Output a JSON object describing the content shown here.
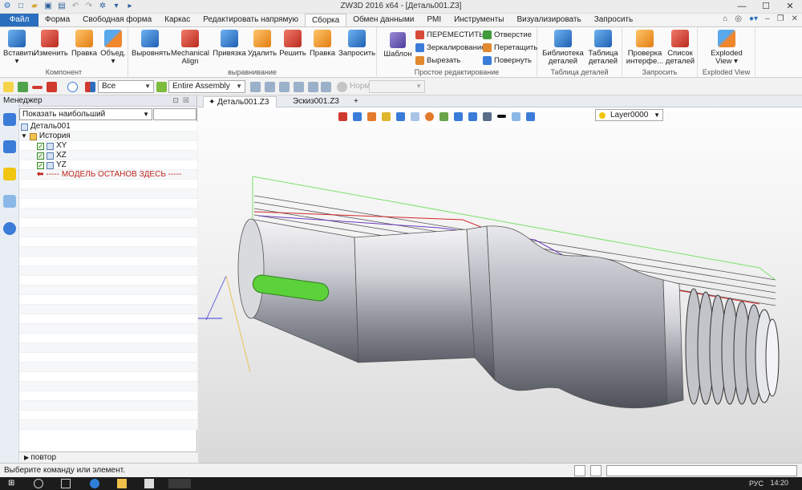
{
  "window": {
    "title": "ZW3D 2016  x64 - [Деталь001.Z3]"
  },
  "menu": {
    "file": "Файл",
    "tabs": [
      "Форма",
      "Свободная форма",
      "Каркас",
      "Редактировать напрямую",
      "Сборка",
      "Обмен данными",
      "PMI",
      "Инструменты",
      "Визуализировать",
      "Запросить"
    ],
    "active_tab": "Сборка"
  },
  "ribbon": {
    "component": {
      "label": "Компонент",
      "buttons": [
        "Вставить",
        "Изменить",
        "Правка",
        "Объед."
      ]
    },
    "align": {
      "label": "выравнивание",
      "buttons": [
        "Выровнять",
        "Mechanical",
        "Align",
        "Привязка",
        "Удалить",
        "Решить",
        "Правка",
        "Запросить"
      ]
    },
    "edit": {
      "label": "Простое редактирование",
      "pattern": "Шаблон",
      "move": "ПЕРЕМЕСТИТЬ",
      "mirror": "Зеркалирование",
      "cut": "Вырезать",
      "hole": "Отверстие",
      "drag": "Перетащить",
      "rotate": "Повернуть"
    },
    "parts_table": {
      "label": "Таблица деталей",
      "buttons": [
        "Библиотека",
        "деталей",
        "Таблица",
        "деталей"
      ]
    },
    "query": {
      "label": "Запросить",
      "buttons": [
        "Проверка",
        "интерфе...",
        "Список",
        "деталей"
      ]
    },
    "exploded": {
      "label": "Exploded View",
      "button_line1": "Exploded",
      "button_line2": "View"
    }
  },
  "toolbar": {
    "filter_value": "Все",
    "assembly_value": "Entire Assembly",
    "norm_label": "Норм."
  },
  "manager": {
    "title": "Менеджер",
    "filter": "Показать наибольший",
    "tree": {
      "root": "Деталь001",
      "history": "История",
      "planes": [
        "XY",
        "XZ",
        "YZ"
      ],
      "stop_marker": "----- МОДЕЛЬ ОСТАНОВ ЗДЕСЬ -----"
    },
    "footer": "повтор"
  },
  "documents": {
    "tabs": [
      "Деталь001.Z3",
      "Эскиз001.Z3"
    ],
    "add": "+"
  },
  "viewport": {
    "layer": "Layer0000"
  },
  "status": {
    "message": "Выберите команду или элемент."
  },
  "taskbar": {
    "lang": "РУС",
    "time": "14:20"
  },
  "colors": {
    "accent": "#2a6ebd",
    "stop_text": "#c0281e",
    "groove": "#5bd23a"
  }
}
